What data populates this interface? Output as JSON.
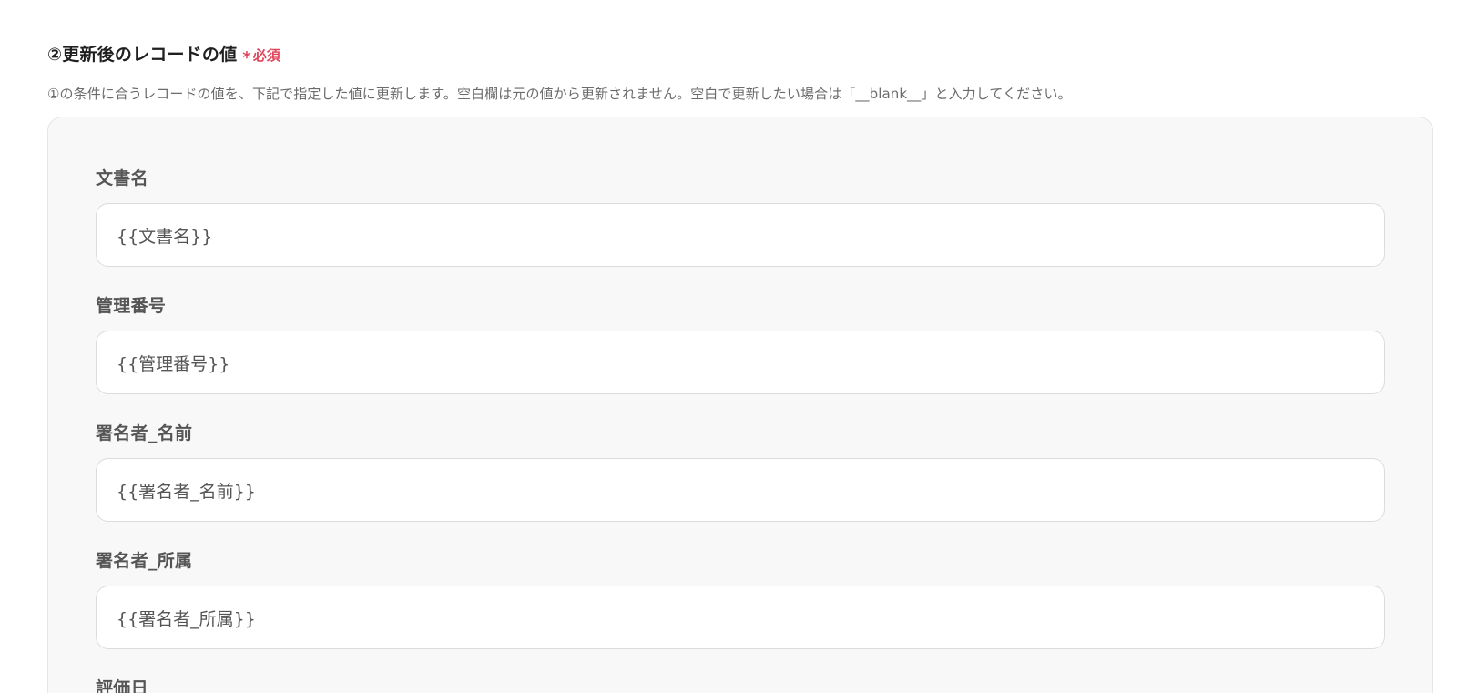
{
  "section": {
    "title": "②更新後のレコードの値",
    "required_star": "*",
    "required_label": "必須",
    "description": "①の条件に合うレコードの値を、下記で指定した値に更新します。空白欄は元の値から更新されません。空白で更新したい場合は「__blank__」と入力してください。"
  },
  "fields": [
    {
      "label": "文書名",
      "value": "{{文書名}}"
    },
    {
      "label": "管理番号",
      "value": "{{管理番号}}"
    },
    {
      "label": "署名者_名前",
      "value": "{{署名者_名前}}"
    },
    {
      "label": "署名者_所属",
      "value": "{{署名者_所属}}"
    },
    {
      "label": "評価日",
      "value": ""
    }
  ],
  "colors": {
    "required": "#e0445a",
    "panel_bg": "#f8f8f8",
    "label": "#555555",
    "description": "#6b6b6b"
  }
}
